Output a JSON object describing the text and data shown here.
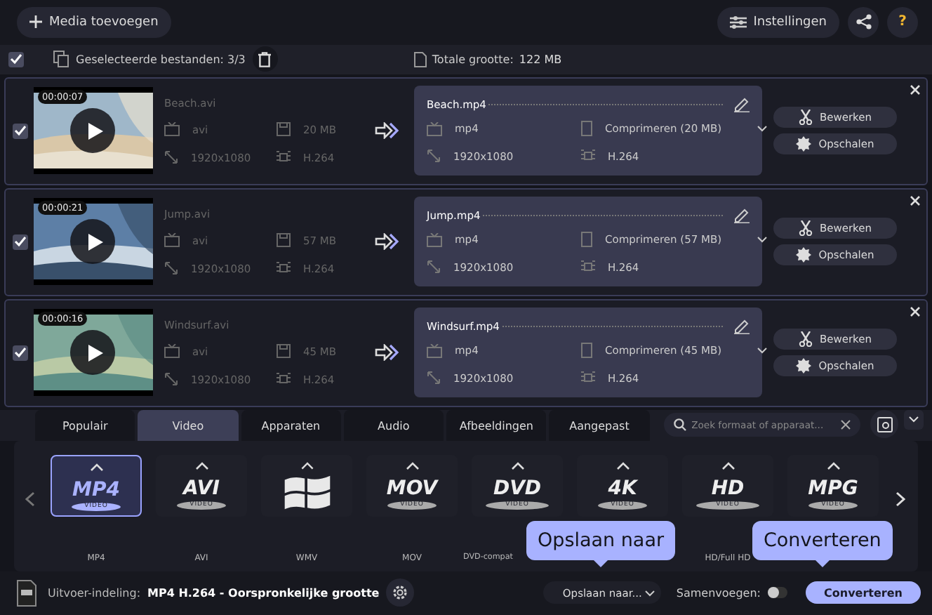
{
  "toolbar": {
    "add_media": "Media toevoegen",
    "settings": "Instellingen",
    "help": "?"
  },
  "selection": {
    "checked": true,
    "selected_label": "Geselecteerde bestanden: 3/3",
    "total_label": "Totale grootte:",
    "total_value": "122 MB"
  },
  "files": [
    {
      "checked": true,
      "duration": "00:00:07",
      "source": {
        "name": "Beach.avi",
        "format": "avi",
        "size": "20 MB",
        "resolution": "1920x1080",
        "codec": "H.264"
      },
      "output": {
        "name": "Beach.mp4",
        "format": "mp4",
        "compress": "Comprimeren (20 MB)",
        "resolution": "1920x1080",
        "codec": "H.264"
      },
      "buttons": [
        "Bewerken",
        "Opschalen"
      ]
    },
    {
      "checked": true,
      "duration": "00:00:21",
      "source": {
        "name": "Jump.avi",
        "format": "avi",
        "size": "57 MB",
        "resolution": "1920x1080",
        "codec": "H.264"
      },
      "output": {
        "name": "Jump.mp4",
        "format": "mp4",
        "compress": "Comprimeren (57 MB)",
        "resolution": "1920x1080",
        "codec": "H.264"
      },
      "buttons": [
        "Bewerken",
        "Opschalen"
      ]
    },
    {
      "checked": true,
      "duration": "00:00:16",
      "source": {
        "name": "Windsurf.avi",
        "format": "avi",
        "size": "45 MB",
        "resolution": "1920x1080",
        "codec": "H.264"
      },
      "output": {
        "name": "Windsurf.mp4",
        "format": "mp4",
        "compress": "Comprimeren (45 MB)",
        "resolution": "1920x1080",
        "codec": "H.264"
      },
      "buttons": [
        "Bewerken",
        "Opschalen"
      ]
    }
  ],
  "format_tabs": [
    {
      "label": "Populair",
      "selected": false
    },
    {
      "label": "Video",
      "selected": true
    },
    {
      "label": "Apparaten",
      "selected": false
    },
    {
      "label": "Audio",
      "selected": false
    },
    {
      "label": "Afbeeldingen",
      "selected": false
    },
    {
      "label": "Aangepast",
      "selected": false
    }
  ],
  "search": {
    "placeholder": "Zoek formaat of apparaat..."
  },
  "formats": [
    {
      "kind": "logo",
      "logo": "MP4",
      "sub": "VIDEO",
      "label": "MP4",
      "selected": true
    },
    {
      "kind": "logo",
      "logo": "AVI",
      "sub": "VIDEO",
      "label": "AVI",
      "selected": false
    },
    {
      "kind": "windows",
      "label": "WMV",
      "selected": false
    },
    {
      "kind": "logo",
      "logo": "MOV",
      "sub": "VIDEO",
      "label": "MOV",
      "selected": false
    },
    {
      "kind": "disc",
      "logo": "DVD",
      "sub": "VIDEO",
      "label": "DVD-compat",
      "selected": false
    },
    {
      "kind": "logo",
      "logo": "4K",
      "sub": "VIDEO",
      "selected": false
    },
    {
      "kind": "disc",
      "logo": "HD",
      "sub": "VIDEO",
      "label": "HD/Full HD",
      "selected": false
    },
    {
      "kind": "logo",
      "logo": "MPG",
      "sub": "VIDEO",
      "selected": false
    }
  ],
  "bottom": {
    "output_label": "Uitvoer-indeling:",
    "output_value": "MP4 H.264 - Oorspronkelijke grootte",
    "save_to": "Opslaan naar...",
    "merge_label": "Samenvoegen:",
    "merge_on": false,
    "convert": "Converteren"
  },
  "callouts": [
    {
      "text": "Opslaan naar"
    },
    {
      "text": "Converteren"
    }
  ]
}
